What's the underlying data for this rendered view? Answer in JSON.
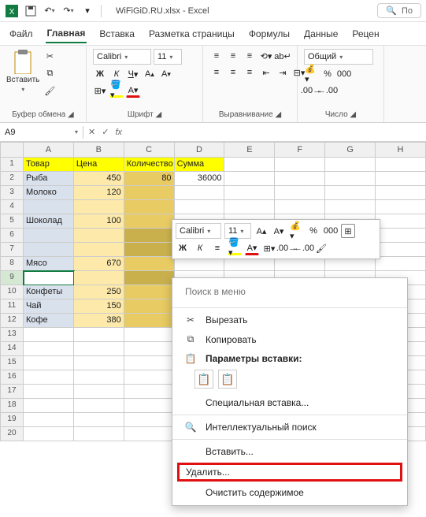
{
  "title": {
    "filename": "WiFiGiD.RU.xlsx",
    "app": "Excel",
    "search": "По"
  },
  "menu": {
    "file": "Файл",
    "home": "Главная",
    "insert": "Вставка",
    "layout": "Разметка страницы",
    "formulas": "Формулы",
    "data": "Данные",
    "review": "Рецен"
  },
  "ribbon": {
    "clipboard": {
      "paste": "Вставить",
      "label": "Буфер обмена"
    },
    "font": {
      "name": "Calibri",
      "size": "11",
      "label": "Шрифт",
      "bold": "Ж",
      "italic": "К",
      "underline": "Ч"
    },
    "align": {
      "label": "Выравнивание"
    },
    "number": {
      "format": "Общий",
      "label": "Число"
    }
  },
  "namebox": "A9",
  "headers": {
    "A": "Товар",
    "B": "Цена",
    "C": "Количество",
    "D": "Сумма"
  },
  "rows": [
    {
      "n": "1"
    },
    {
      "n": "2",
      "a": "Рыба",
      "b": "450",
      "c": "80",
      "d": "36000"
    },
    {
      "n": "3",
      "a": "Молоко",
      "b": "120"
    },
    {
      "n": "4"
    },
    {
      "n": "5",
      "a": "Шоколад",
      "b": "100"
    },
    {
      "n": "6"
    },
    {
      "n": "7"
    },
    {
      "n": "8",
      "a": "Мясо",
      "b": "670"
    },
    {
      "n": "9"
    },
    {
      "n": "10",
      "a": "Конфеты",
      "b": "250"
    },
    {
      "n": "11",
      "a": "Чай",
      "b": "150"
    },
    {
      "n": "12",
      "a": "Кофе",
      "b": "380"
    },
    {
      "n": "13"
    },
    {
      "n": "14"
    },
    {
      "n": "15"
    },
    {
      "n": "16"
    },
    {
      "n": "17"
    },
    {
      "n": "18"
    },
    {
      "n": "19"
    },
    {
      "n": "20"
    }
  ],
  "cols": [
    "A",
    "B",
    "C",
    "D",
    "E",
    "F",
    "G",
    "H"
  ],
  "mini": {
    "font": "Calibri",
    "size": "11",
    "bold": "Ж",
    "italic": "К"
  },
  "ctx": {
    "search_ph": "Поиск в меню",
    "cut": "Вырезать",
    "copy": "Копировать",
    "paste_opts": "Параметры вставки:",
    "paste_special": "Специальная вставка...",
    "smart": "Интеллектуальный поиск",
    "insert": "Вставить...",
    "delete": "Удалить...",
    "clear": "Очистить содержимое"
  }
}
